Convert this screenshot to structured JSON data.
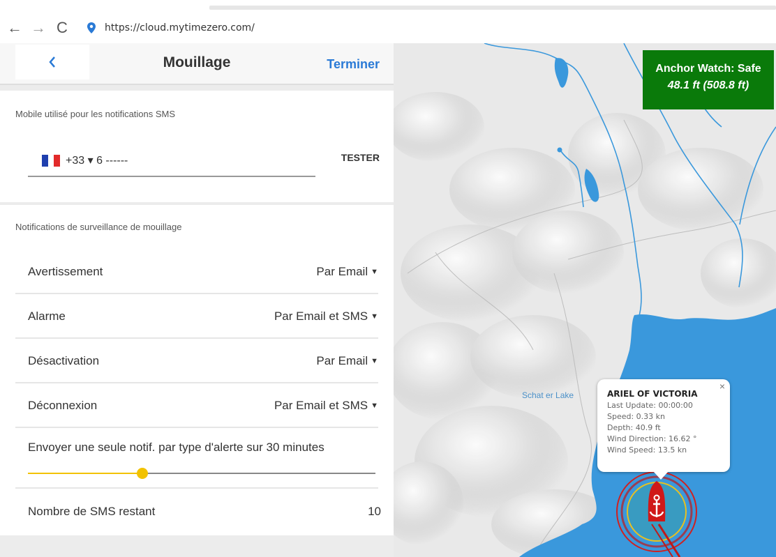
{
  "browser": {
    "back_glyph": "←",
    "forward_glyph": "→",
    "reload_glyph": "C",
    "url": "https://cloud.mytimezero.com/"
  },
  "header": {
    "back_glyph": "‹",
    "title": "Mouillage",
    "done": "Terminer"
  },
  "sms_section": {
    "title": "Mobile utilisé pour les notifications SMS",
    "phone_value": "+33 ▾ 6 ------",
    "test_button": "TESTER"
  },
  "watch_section": {
    "title": "Notifications de surveillance de mouillage",
    "options": [
      {
        "label": "Avertissement",
        "value": "Par Email"
      },
      {
        "label": "Alarme",
        "value": "Par Email et SMS"
      },
      {
        "label": "Désactivation",
        "value": "Par Email"
      },
      {
        "label": "Déconnexion",
        "value": "Par Email et SMS"
      }
    ],
    "single_notif_label": "Envoyer une seule notif. par type d'alerte sur 30 minutes",
    "slider_fraction": 0.33,
    "sms_remaining_label": "Nombre de SMS restant",
    "sms_remaining_value": "10"
  },
  "map": {
    "anchor_watch_title": "Anchor Watch: Safe",
    "anchor_watch_distance": "48.1 ft (508.8 ft)",
    "lake_label": "Schat er Lake",
    "popup": {
      "close_glyph": "×",
      "vessel_name": "ARIEL OF VICTORIA",
      "lines": [
        "Last Update: 00:00:00",
        "Speed: 0.33 kn",
        "Depth: 40.9 ft",
        "Wind Direction: 16.62 °",
        "Wind Speed: 13.5 kn"
      ]
    }
  },
  "colors": {
    "accent_blue": "#2a7ad6",
    "safe_green": "#0a7a0a",
    "slider_yellow": "#f2c200",
    "water_blue": "#3a98dc",
    "alarm_red": "#d02020"
  }
}
